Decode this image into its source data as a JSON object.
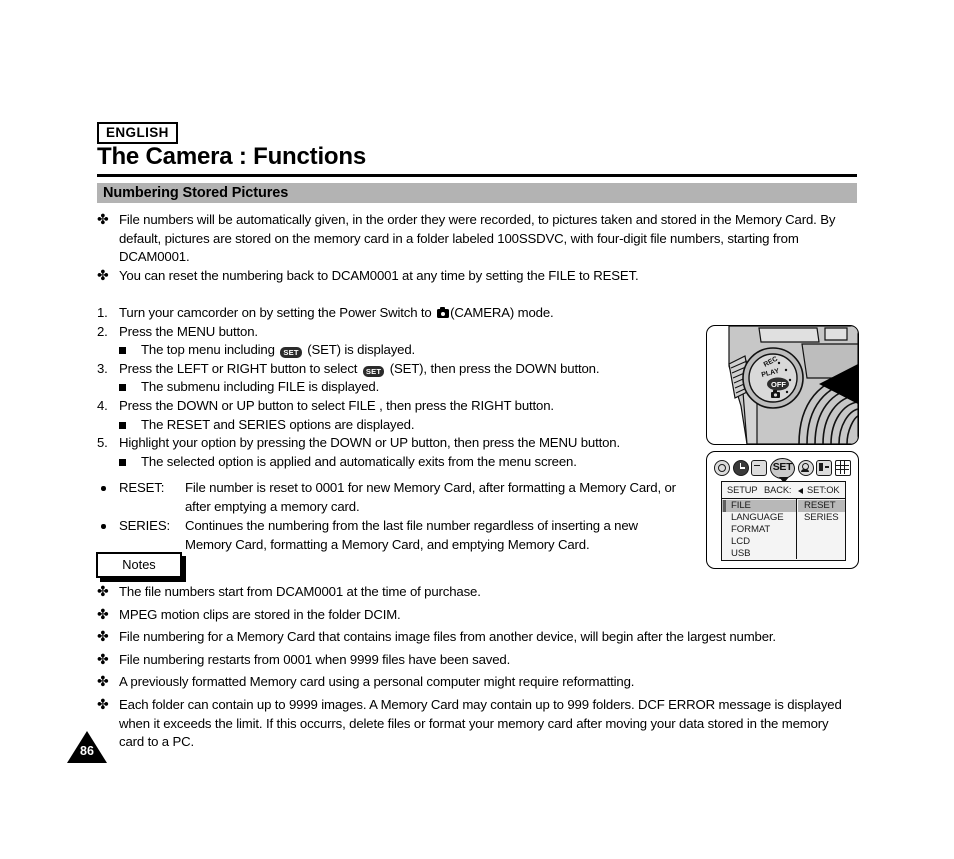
{
  "header": {
    "language_badge": "ENGLISH",
    "title": "The Camera : Functions",
    "section": "Numbering Stored Pictures"
  },
  "intro_bullets": [
    "File numbers will be automatically given, in the order they were recorded, to pictures taken and stored in the Memory Card. By default, pictures are stored on the memory card in a folder labeled 100SSDVC, with four-digit file numbers, starting from DCAM0001.",
    "You can reset the numbering back to DCAM0001 at any time by setting the FILE to RESET."
  ],
  "steps": [
    {
      "number": "1.",
      "text_before": "Turn your camcorder on by setting the Power Switch to ",
      "icon": "camera-icon",
      "text_after": "(CAMERA) mode.",
      "subs": []
    },
    {
      "number": "2.",
      "text_before": "Press the MENU button.",
      "subs": [
        {
          "before": "The top menu including ",
          "icon": "set-icon",
          "after": " (SET) is displayed."
        }
      ]
    },
    {
      "number": "3.",
      "text_before": "Press the LEFT or RIGHT button to select ",
      "icon": "set-icon",
      "text_after": " (SET), then press the DOWN button.",
      "subs": [
        {
          "before": "The submenu including  FILE  is displayed.",
          "icon": "",
          "after": ""
        }
      ]
    },
    {
      "number": "4.",
      "text_before": "Press the DOWN or UP button to select  FILE , then press the RIGHT button.",
      "subs": [
        {
          "before": "The RESET and SERIES options are displayed.",
          "icon": "",
          "after": ""
        }
      ]
    },
    {
      "number": "5.",
      "text_before": "Highlight your option by pressing the DOWN or UP button, then press the MENU button.",
      "subs": [
        {
          "before": "The selected option is applied and automatically exits from the menu screen.",
          "icon": "",
          "after": ""
        }
      ]
    }
  ],
  "options": [
    {
      "label": "RESET:",
      "line1": "File number is reset to 0001 for new Memory Card, after formatting a Memory Card, or",
      "line2": "after emptying a memory card."
    },
    {
      "label": "SERIES:",
      "line1": "Continues the numbering from the last file number regardless of inserting a new",
      "line2": "Memory Card, formatting a Memory Card, and emptying Memory Card."
    }
  ],
  "notes": {
    "title": "Notes",
    "items": [
      "The file numbers start from DCAM0001 at the time of purchase.",
      "MPEG motion clips are stored in the folder DCIM.",
      "File numbering for a Memory Card that contains image files from another device, will begin after the largest number.",
      "File numbering restarts from 0001 when 9999 files have been saved.",
      "A previously formatted Memory card using a personal computer might require reformatting.",
      "Each folder can contain up to 9999 images. A Memory Card may contain up to 999 folders.  DCF ERROR  message is displayed when it exceeds the limit. If this occurrs, delete files or format your memory card after moving your data stored in the memory card to a PC."
    ]
  },
  "page_number": "86",
  "illustrations": {
    "power_switch": {
      "name": "camcorder-power-switch",
      "dial_labels": [
        "REC",
        "PLAY",
        "OFF"
      ],
      "selected": "OFF",
      "camera_mode_icon": "camera-icon"
    },
    "osd": {
      "name": "on-screen-display-menu",
      "icon_row": [
        "camera-mode-icon",
        "self-timer-icon",
        "playback-icon",
        "set-icon",
        "user-settings-icon",
        "display-icon",
        "grid-icon"
      ],
      "selected_icon": "SET",
      "header": {
        "title": "SETUP",
        "back_label": "BACK:",
        "set_label": "SET:OK"
      },
      "left_items": [
        "FILE",
        "LANGUAGE",
        "FORMAT",
        "LCD",
        "USB"
      ],
      "left_selected": "FILE",
      "right_items": [
        "RESET",
        "SERIES"
      ],
      "right_selected": "RESET"
    }
  },
  "colors": {
    "section_bar": "#b3b3b3",
    "osd_highlight": "#b8b8b8",
    "rule": "#000000"
  }
}
